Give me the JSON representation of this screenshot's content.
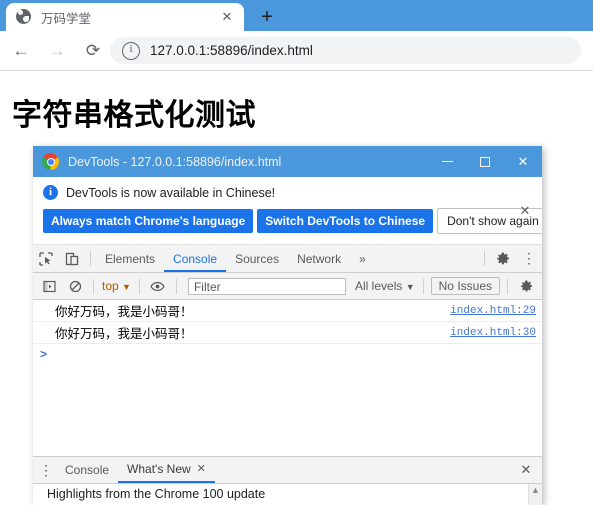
{
  "browser": {
    "tab": {
      "title": "万码学堂",
      "favicon": "globe-icon",
      "close_label": "✕"
    },
    "new_tab_label": "+",
    "nav": {
      "back_label": "←",
      "forward_label": "→",
      "reload_label": "⟳"
    },
    "omnibox": {
      "info_label": "i",
      "url": "127.0.0.1:58896/index.html"
    }
  },
  "page": {
    "heading": "字符串格式化测试"
  },
  "devtools": {
    "titlebar": {
      "logo": "chrome-logo-icon",
      "title": "DevTools - 127.0.0.1:58896/index.html",
      "minimize_label": "—",
      "maximize_label": "□",
      "close_label": "✕"
    },
    "banner": {
      "info_label": "i",
      "message": "DevTools is now available in Chinese!",
      "button_always": "Always match Chrome's language",
      "button_switch": "Switch DevTools to Chinese",
      "button_dismiss": "Don't show again",
      "close_label": "✕",
      "accent_color": "#1a73e8"
    },
    "tabbar": {
      "inspect_icon": "inspect-element-icon",
      "device_icon": "device-toolbar-icon",
      "tabs": [
        {
          "label": "Elements",
          "active": false
        },
        {
          "label": "Console",
          "active": true
        },
        {
          "label": "Sources",
          "active": false
        },
        {
          "label": "Network",
          "active": false
        }
      ],
      "more_label": "»",
      "settings_icon": "gear-icon",
      "menu_label": "⋮",
      "active_color": "#1a73e8"
    },
    "consolebar": {
      "sidebar_toggle_icon": "console-sidebar-icon",
      "clear_icon": "clear-console-icon",
      "context": "top",
      "context_caret": "▼",
      "eye_icon": "live-expression-eye-icon",
      "filter_placeholder": "Filter",
      "filter_value": "",
      "levels": "All levels",
      "levels_caret": "▼",
      "issues": "No Issues",
      "settings_icon": "gear-icon"
    },
    "console": {
      "messages": [
        {
          "text": "你好万码，我是小码哥！",
          "source": "index.html:29"
        },
        {
          "text": "你好万码，我是小码哥！",
          "source": "index.html:30"
        }
      ],
      "prompt": ">",
      "link_color": "#4275d4"
    },
    "drawer": {
      "menu_label": "⋮",
      "tabs": [
        {
          "label": "Console",
          "active": false,
          "closable": false
        },
        {
          "label": "What's New",
          "active": true,
          "closable": true,
          "close_label": "✕"
        }
      ],
      "close_label": "✕",
      "content_headline": "Highlights from the Chrome 100 update",
      "scroll_up_label": "▲"
    }
  }
}
